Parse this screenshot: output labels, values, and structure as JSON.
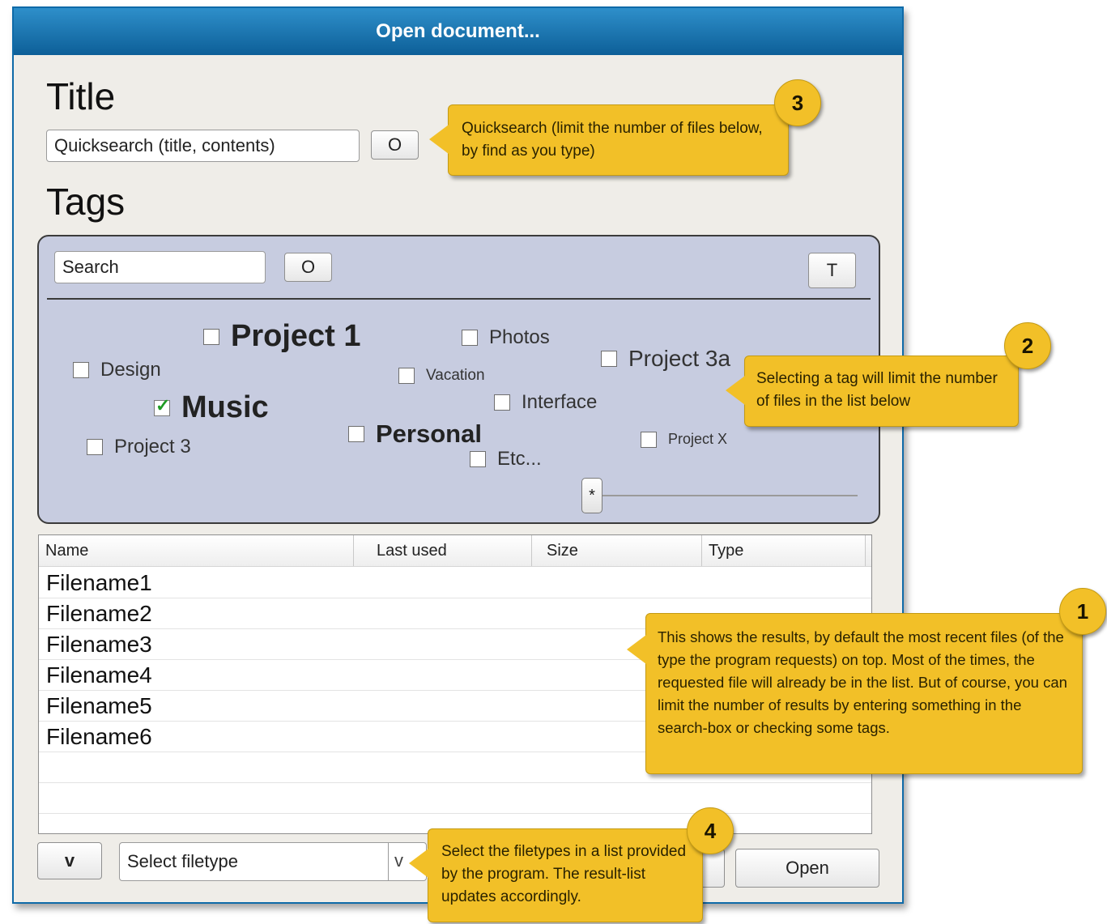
{
  "window": {
    "title": "Open document..."
  },
  "title_section": {
    "heading": "Title",
    "quicksearch_value": "Quicksearch (title, contents)",
    "search_button": "O"
  },
  "tags_section": {
    "heading": "Tags",
    "search_value": "Search",
    "search_button": "O",
    "t_button": "T",
    "tags": [
      {
        "label": "Project 1",
        "checked": false
      },
      {
        "label": "Photos",
        "checked": false
      },
      {
        "label": "Design",
        "checked": false
      },
      {
        "label": "Project 3a",
        "checked": false
      },
      {
        "label": "Vacation",
        "checked": false
      },
      {
        "label": "Music",
        "checked": true
      },
      {
        "label": "Interface",
        "checked": false
      },
      {
        "label": "Personal",
        "checked": false
      },
      {
        "label": "Project 3",
        "checked": false
      },
      {
        "label": "Project X",
        "checked": false
      },
      {
        "label": "Etc...",
        "checked": false
      }
    ],
    "slider_label": "*"
  },
  "file_list": {
    "columns": [
      "Name",
      "Last used",
      "Size",
      "Type"
    ],
    "rows": [
      "Filename1",
      "Filename2",
      "Filename3",
      "Filename4",
      "Filename5",
      "Filename6"
    ]
  },
  "bottom_bar": {
    "v_button": "v",
    "filetype_value": "Select filetype",
    "dropdown_arrow": "v",
    "cancel_partial": "el",
    "open_button": "Open"
  },
  "callouts": {
    "c1": {
      "number": "1",
      "text": "This shows the results, by default the most recent files (of the type the program requests) on top. Most of the times, the requested file will already be in the list. But of course, you can limit the number of results by entering something in the search-box or checking some tags."
    },
    "c2": {
      "number": "2",
      "text": "Selecting a tag will limit the number of files in the list below"
    },
    "c3": {
      "number": "3",
      "text": "Quicksearch (limit the number of files below, by find as you type)"
    },
    "c4": {
      "number": "4",
      "text": "Select the filetypes in a list provided by the program. The result-list updates accordingly."
    }
  },
  "colors": {
    "titlebar": "#1f7bb9",
    "tag_panel": "#c7cce0",
    "callout": "#f2c028",
    "check": "#1e9b23"
  }
}
